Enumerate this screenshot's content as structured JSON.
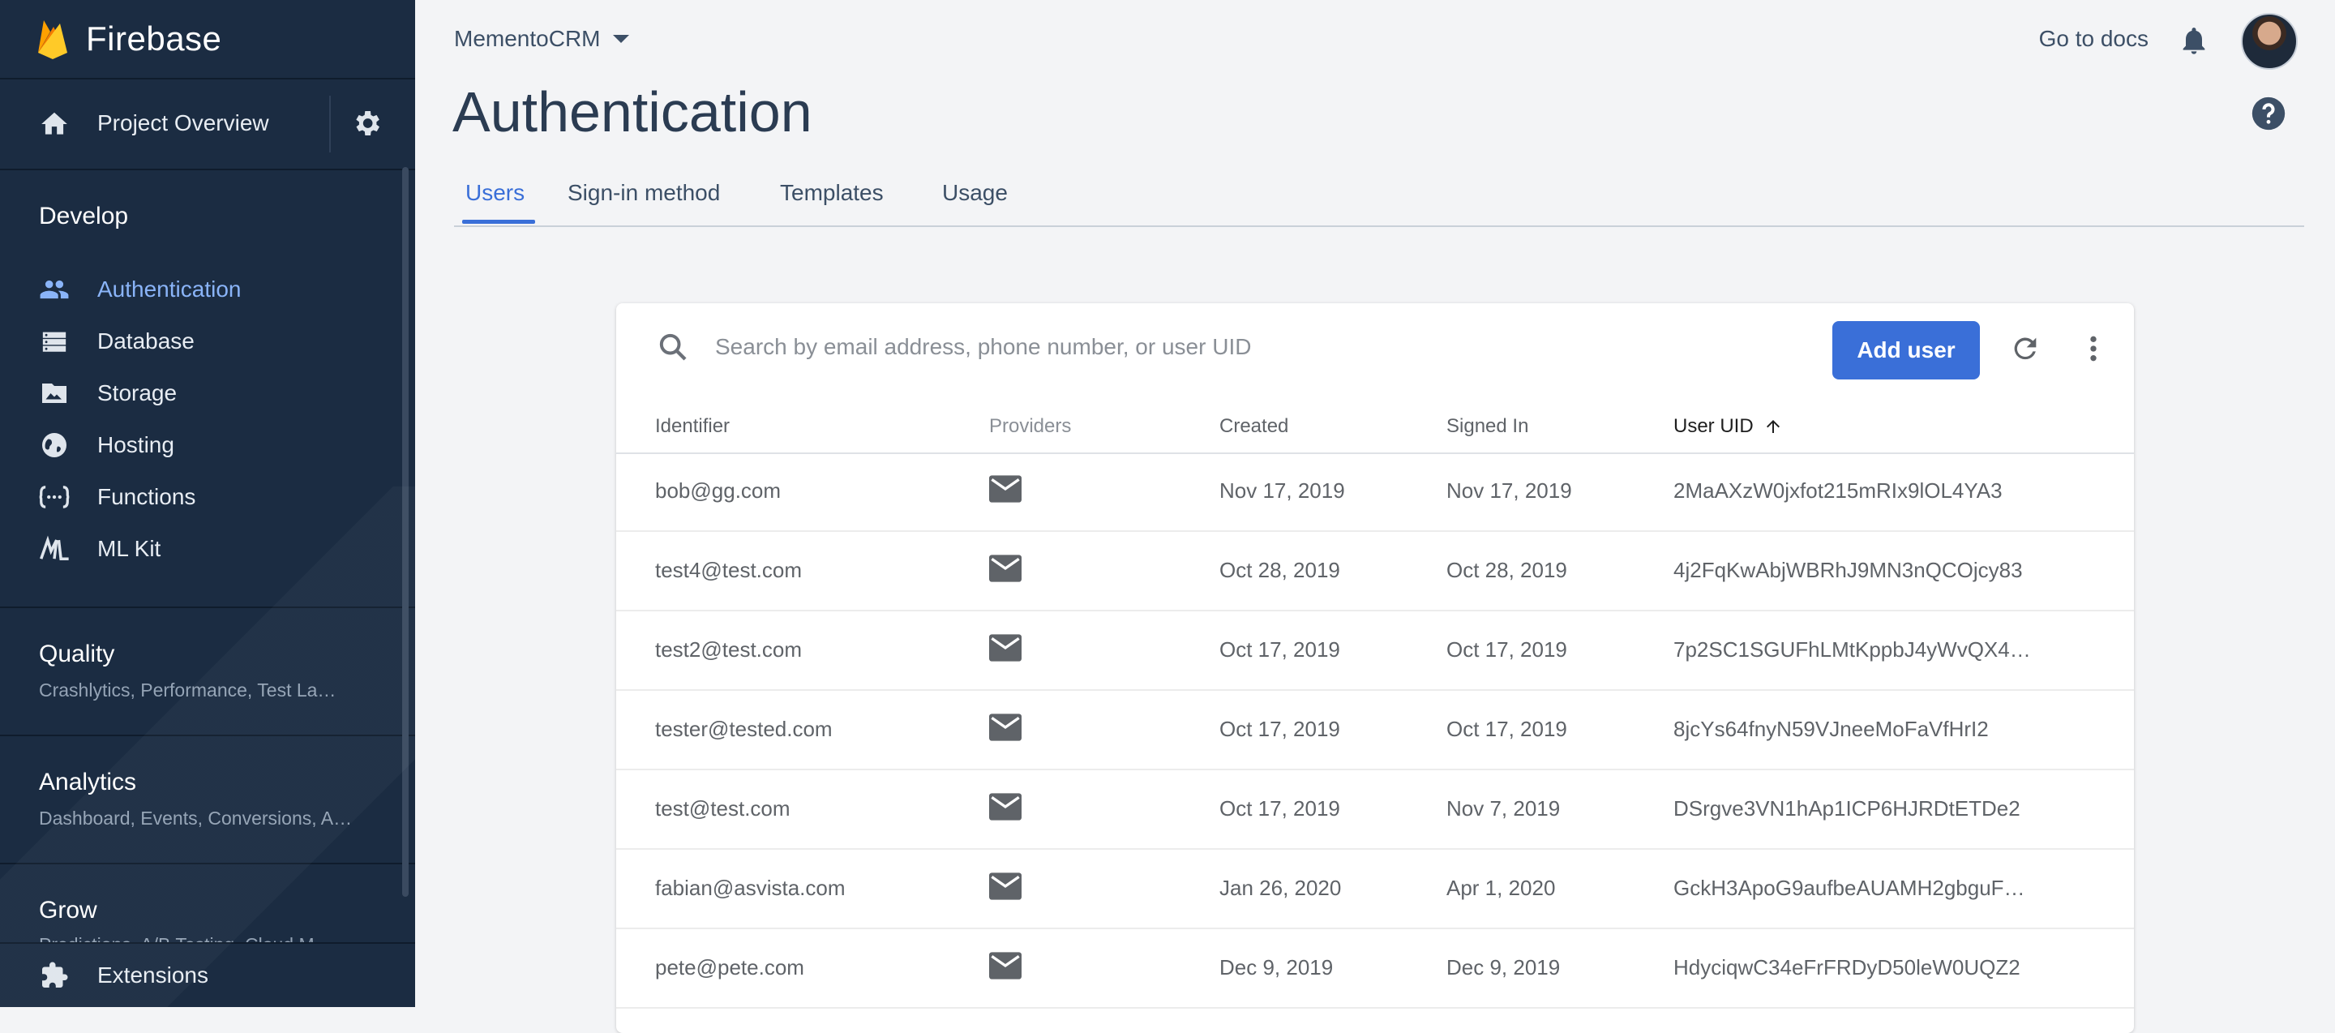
{
  "sidebar": {
    "brand": "Firebase",
    "overview_label": "Project Overview",
    "develop": {
      "title": "Develop",
      "items": [
        {
          "label": "Authentication",
          "icon": "people-icon",
          "active": true
        },
        {
          "label": "Database",
          "icon": "database-icon"
        },
        {
          "label": "Storage",
          "icon": "photo-icon"
        },
        {
          "label": "Hosting",
          "icon": "globe-icon"
        },
        {
          "label": "Functions",
          "icon": "functions-icon"
        },
        {
          "label": "ML Kit",
          "icon": "mlkit-icon"
        }
      ]
    },
    "quality": {
      "title": "Quality",
      "subtitle": "Crashlytics, Performance, Test La…"
    },
    "analytics": {
      "title": "Analytics",
      "subtitle": "Dashboard, Events, Conversions, A…"
    },
    "grow": {
      "title": "Grow",
      "subtitle": "Predictions, A/B Testing, Cloud M…"
    },
    "extensions_label": "Extensions"
  },
  "header": {
    "project": "MementoCRM",
    "docs_label": "Go to docs",
    "title": "Authentication",
    "tabs": [
      "Users",
      "Sign-in method",
      "Templates",
      "Usage"
    ],
    "active_tab": "Users"
  },
  "users": {
    "search_placeholder": "Search by email address, phone number, or user UID",
    "add_user_label": "Add user",
    "columns": [
      "Identifier",
      "Providers",
      "Created",
      "Signed In",
      "User UID"
    ],
    "sorted_column": "User UID",
    "rows": [
      {
        "identifier": "bob@gg.com",
        "provider": "email",
        "created": "Nov 17, 2019",
        "signed_in": "Nov 17, 2019",
        "uid": "2MaAXzW0jxfot215mRIx9lOL4YA3"
      },
      {
        "identifier": "test4@test.com",
        "provider": "email",
        "created": "Oct 28, 2019",
        "signed_in": "Oct 28, 2019",
        "uid": "4j2FqKwAbjWBRhJ9MN3nQCOjcy83"
      },
      {
        "identifier": "test2@test.com",
        "provider": "email",
        "created": "Oct 17, 2019",
        "signed_in": "Oct 17, 2019",
        "uid": "7p2SC1SGUFhLMtKppbJ4yWvQX4…"
      },
      {
        "identifier": "tester@tested.com",
        "provider": "email",
        "created": "Oct 17, 2019",
        "signed_in": "Oct 17, 2019",
        "uid": "8jcYs64fnyN59VJneeMoFaVfHrI2"
      },
      {
        "identifier": "test@test.com",
        "provider": "email",
        "created": "Oct 17, 2019",
        "signed_in": "Nov 7, 2019",
        "uid": "DSrgve3VN1hAp1ICP6HJRDtETDe2"
      },
      {
        "identifier": "fabian@asvista.com",
        "provider": "email",
        "created": "Jan 26, 2020",
        "signed_in": "Apr 1, 2020",
        "uid": "GckH3ApoG9aufbeAUAMH2gbguF…"
      },
      {
        "identifier": "pete@pete.com",
        "provider": "email",
        "created": "Dec 9, 2019",
        "signed_in": "Dec 9, 2019",
        "uid": "HdyciqwC34eFrFRDyD50leW0UQZ2"
      }
    ]
  },
  "colors": {
    "sidebar_bg": "#1b2c42",
    "accent": "#3a6fd8",
    "active_nav": "#8ab4f8"
  }
}
